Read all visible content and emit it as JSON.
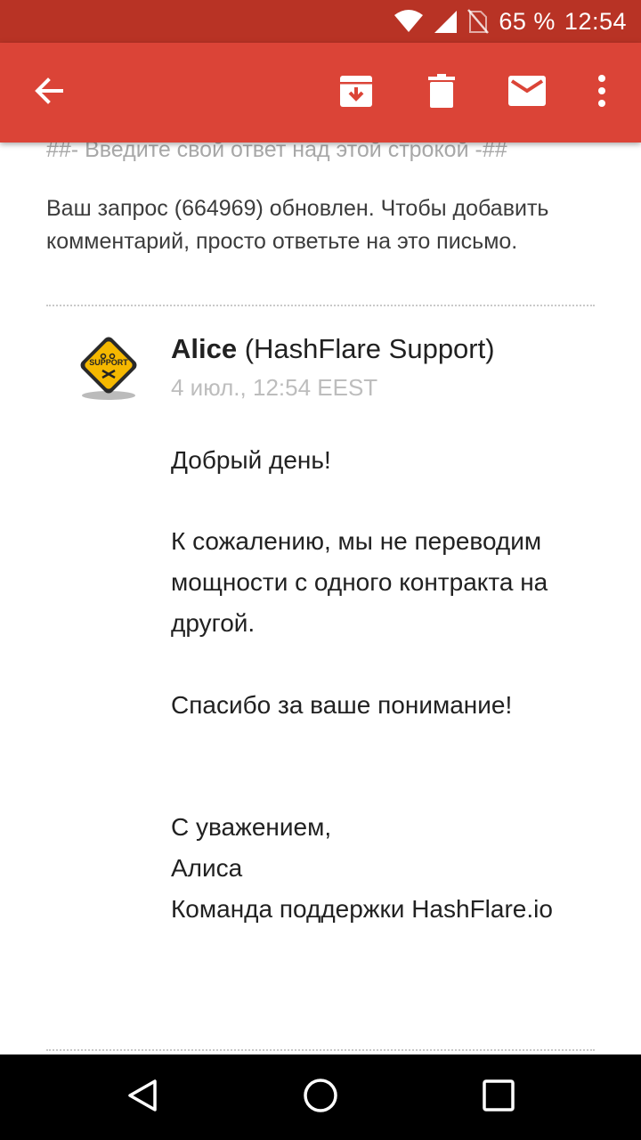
{
  "status_bar": {
    "battery": "65 %",
    "time": "12:54",
    "icons": [
      "wifi-icon",
      "cell-signal-icon",
      "no-sim-icon"
    ]
  },
  "toolbar": {
    "actions": [
      "back-arrow-icon",
      "archive-icon",
      "delete-icon",
      "mark-unread-icon",
      "more-vert-icon"
    ],
    "color": "#db4437"
  },
  "email": {
    "reply_line": "##- Введите свой ответ над этой строкой -##",
    "update_notice": "Ваш запрос (664969) обновлен. Чтобы добавить комментарий, просто ответьте на это письмо.",
    "message": {
      "sender_name": "Alice",
      "sender_org": " (HashFlare Support)",
      "avatar_text": "SUPPORT",
      "date": "4 июл., 12:54 EEST",
      "greeting": "Добрый день!",
      "paragraph1_line1": "К сожалению, мы не переводим",
      "paragraph1_line2": "мощности с одного контракта на",
      "paragraph1_line3": "другой.",
      "thanks": "Спасибо за ваше понимание!",
      "signoff": "С уважением,",
      "signature_name": "Алиса",
      "signature_team": "Команда поддержки HashFlare.io"
    }
  },
  "nav_bar": {
    "buttons": [
      "nav-back-icon",
      "nav-home-icon",
      "nav-recents-icon"
    ]
  }
}
